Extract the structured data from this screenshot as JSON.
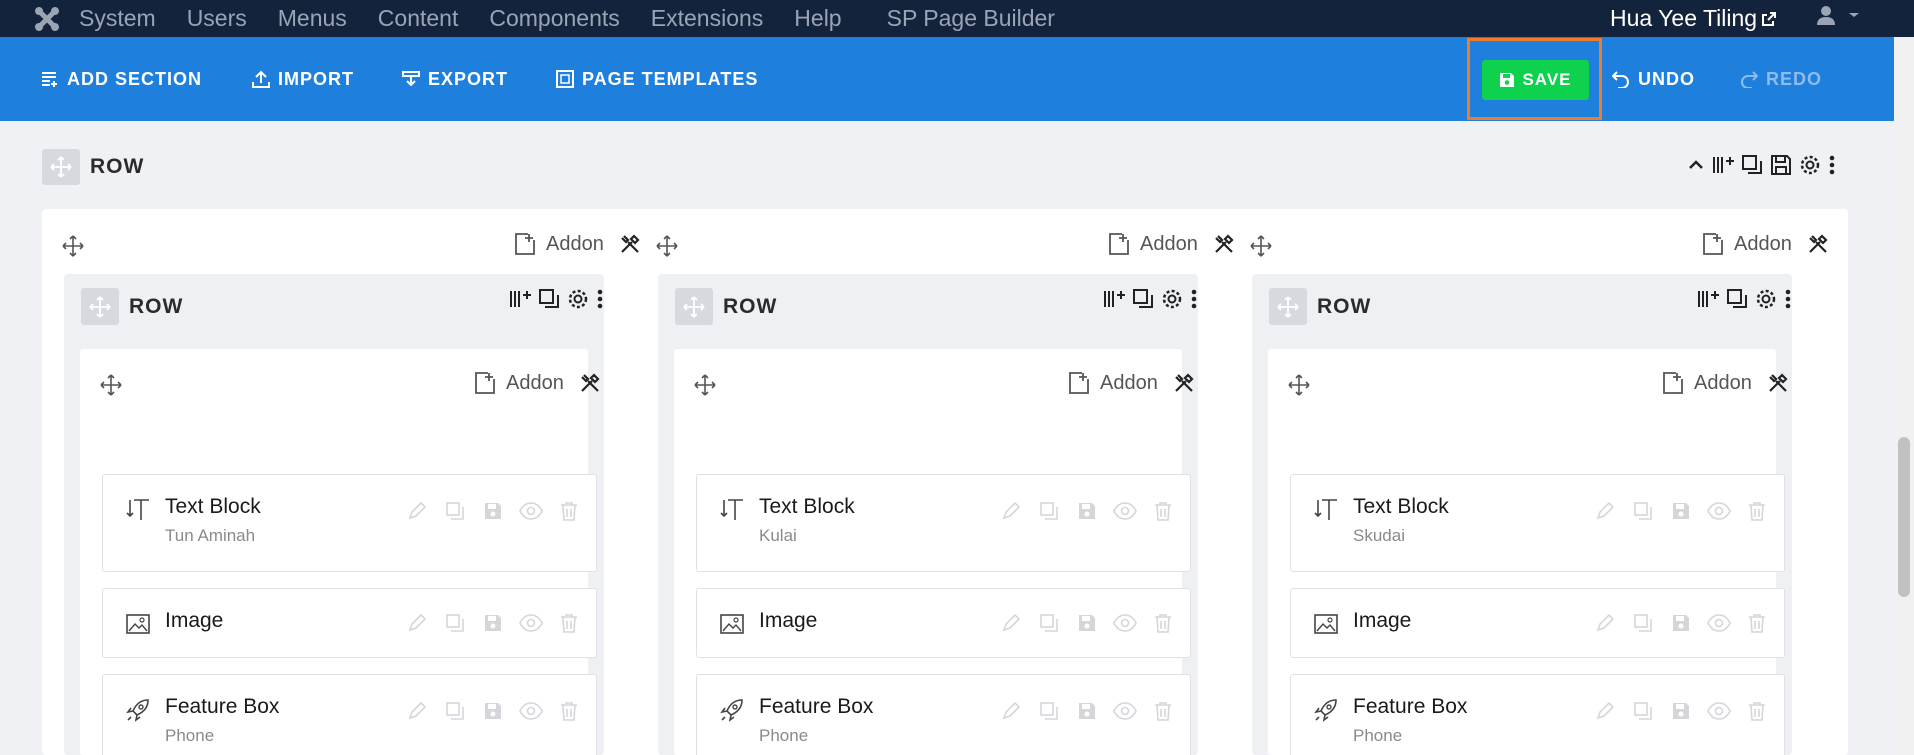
{
  "topbar": {
    "menu": [
      "System",
      "Users",
      "Menus",
      "Content",
      "Components",
      "Extensions",
      "Help"
    ],
    "sp_menu": "SP Page Builder",
    "user_name": "Hua Yee Tiling"
  },
  "toolbar": {
    "add_section": "ADD SECTION",
    "import": "IMPORT",
    "export": "EXPORT",
    "page_templates": "PAGE TEMPLATES",
    "save": "SAVE",
    "undo": "UNDO",
    "redo": "REDO"
  },
  "outer_row": {
    "label": "ROW"
  },
  "addon_label": "Addon",
  "columns": [
    {
      "row_label": "ROW",
      "addons": [
        {
          "type": "text",
          "title": "Text Block",
          "subtitle": "Tun Aminah"
        },
        {
          "type": "image",
          "title": "Image",
          "subtitle": ""
        },
        {
          "type": "feature",
          "title": "Feature Box",
          "subtitle": "Phone"
        }
      ]
    },
    {
      "row_label": "ROW",
      "addons": [
        {
          "type": "text",
          "title": "Text Block",
          "subtitle": "Kulai"
        },
        {
          "type": "image",
          "title": "Image",
          "subtitle": ""
        },
        {
          "type": "feature",
          "title": "Feature Box",
          "subtitle": "Phone"
        }
      ]
    },
    {
      "row_label": "ROW",
      "addons": [
        {
          "type": "text",
          "title": "Text Block",
          "subtitle": "Skudai"
        },
        {
          "type": "image",
          "title": "Image",
          "subtitle": ""
        },
        {
          "type": "feature",
          "title": "Feature Box",
          "subtitle": "Phone"
        }
      ]
    }
  ],
  "colors": {
    "toolbar": "#1f7fdc",
    "topbar": "#14233c",
    "save": "#0ed14d",
    "highlight": "#ef7b2e"
  }
}
